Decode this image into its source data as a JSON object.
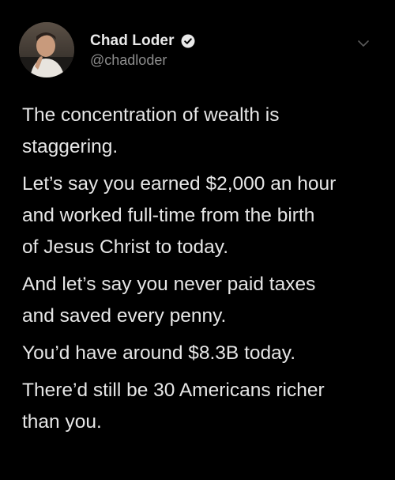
{
  "author": {
    "display_name": "Chad Loder",
    "handle": "@chadloder",
    "verified_icon": "verified-badge-icon"
  },
  "menu_icon": "chevron-down-icon",
  "tweet": {
    "paragraphs": [
      "The concentration of wealth is\nstaggering.",
      "Let’s say you earned $2,000 an hour\nand worked full-time from the birth\nof Jesus Christ to today.",
      "And let’s say you never paid taxes\nand saved every penny.",
      "You’d have around $8.3B today.",
      "There’d still be 30 Americans richer\nthan you."
    ]
  },
  "colors": {
    "background": "#000000",
    "text": "#e6e6e6",
    "handle": "#8e8e8e"
  }
}
